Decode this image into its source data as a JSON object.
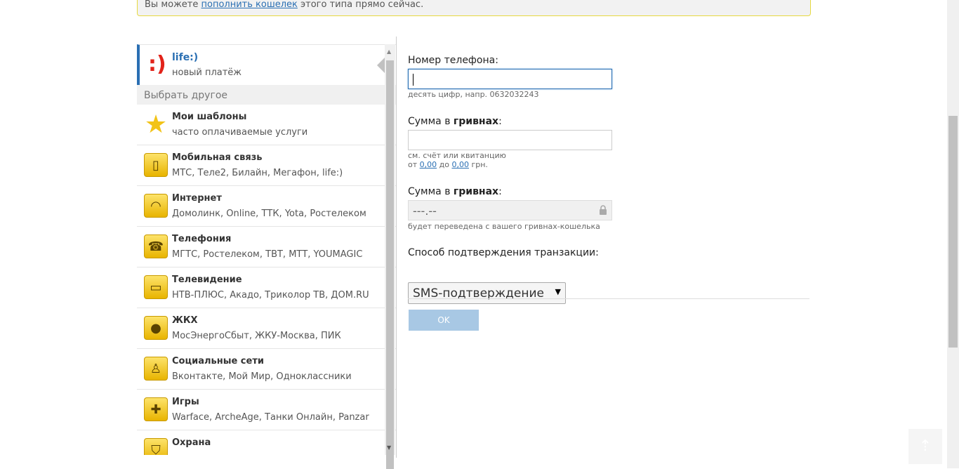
{
  "notice": {
    "prefix": "Вы можете ",
    "link": "пополнить кошелек",
    "suffix": " этого типа прямо сейчас."
  },
  "current": {
    "icon": "life-smiley",
    "icon_text": ":)",
    "name": "life:)",
    "sub": "новый платёж"
  },
  "choose_other": "Выбрать другое",
  "categories": [
    {
      "icon": "star-icon",
      "glyph": "★",
      "title": "Мои шаблоны",
      "desc": "часто оплачиваемые услуги"
    },
    {
      "icon": "mobile-phone-icon",
      "glyph": "▯",
      "title": "Мобильная связь",
      "desc": "МТС, Теле2, Билайн, Мегафон, life:)"
    },
    {
      "icon": "wifi-icon",
      "glyph": "◠",
      "title": "Интернет",
      "desc": "Домолинк, Online, ТТК, Yota, Ростелеком"
    },
    {
      "icon": "telephone-icon",
      "glyph": "☎",
      "title": "Телефония",
      "desc": "МГТС, Ростелеком, ТВТ, МТТ, YOUMAGIC"
    },
    {
      "icon": "tv-icon",
      "glyph": "▭",
      "title": "Телевидение",
      "desc": "НТВ-ПЛЮС, Акадо, Триколор ТВ, ДОМ.RU"
    },
    {
      "icon": "lightbulb-icon",
      "glyph": "●",
      "title": "ЖКХ",
      "desc": "МосЭнергоСбыт, ЖКУ-Москва, ПИК"
    },
    {
      "icon": "people-icon",
      "glyph": "♙",
      "title": "Социальные сети",
      "desc": "Вконтакте, Мой Мир, Одноклассники"
    },
    {
      "icon": "gamepad-icon",
      "glyph": "✚",
      "title": "Игры",
      "desc": "Warface, ArcheAge, Танки Онлайн, Panzar"
    },
    {
      "icon": "shield-icon",
      "glyph": "⛉",
      "title": "Охрана",
      "desc": ""
    }
  ],
  "form": {
    "phone_label": "Номер телефона:",
    "phone_value": "",
    "phone_hint": "десять цифр, напр. 0632032243",
    "amount_label_prefix": "Сумма в ",
    "amount_label_bold": "гривнах",
    "amount_label_suffix": ":",
    "amount_value": "",
    "amount_hint_line1": "см. счёт или квитанцию",
    "amount_hint_from": "от ",
    "amount_min": "0,00",
    "amount_hint_to": " до ",
    "amount_max": "0,00",
    "amount_hint_currency": " грн.",
    "debit_label_prefix": "Сумма в ",
    "debit_label_bold": "гривнах",
    "debit_label_suffix": ":",
    "debit_value": "---.--",
    "debit_hint": "будет переведена с вашего гривнах-кошелька",
    "confirm_label": "Способ подтверждения транзакции:",
    "confirm_selected": "SMS-подтверждение",
    "ok_label": "OK"
  },
  "colors": {
    "accent": "#2a6fb3",
    "notice_border": "#e6d940",
    "ok_button": "#a8c8e4",
    "icon_yellow": "#f2c318"
  }
}
